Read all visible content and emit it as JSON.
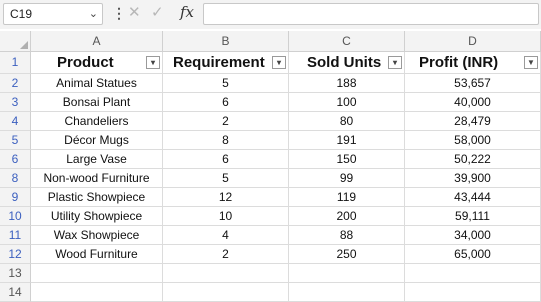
{
  "name_box": {
    "value": "C19"
  },
  "formula_bar": {
    "value": "",
    "fx_label": "fx"
  },
  "columns": [
    "A",
    "B",
    "C",
    "D"
  ],
  "header_row": {
    "row_number": "1",
    "cells": [
      "Product",
      "Requirement",
      "Sold Units",
      "Profit (INR)"
    ]
  },
  "rows": [
    {
      "num": "2",
      "cells": [
        "Animal Statues",
        "5",
        "188",
        "53,657"
      ]
    },
    {
      "num": "3",
      "cells": [
        "Bonsai Plant",
        "6",
        "100",
        "40,000"
      ]
    },
    {
      "num": "4",
      "cells": [
        "Chandeliers",
        "2",
        "80",
        "28,479"
      ]
    },
    {
      "num": "5",
      "cells": [
        "Décor Mugs",
        "8",
        "191",
        "58,000"
      ]
    },
    {
      "num": "6",
      "cells": [
        "Large Vase",
        "6",
        "150",
        "50,222"
      ]
    },
    {
      "num": "8",
      "cells": [
        "Non-wood Furniture",
        "5",
        "99",
        "39,900"
      ]
    },
    {
      "num": "9",
      "cells": [
        "Plastic Showpiece",
        "12",
        "119",
        "43,444"
      ]
    },
    {
      "num": "10",
      "cells": [
        "Utility Showpiece",
        "10",
        "200",
        "59,111"
      ]
    },
    {
      "num": "11",
      "cells": [
        "Wax Showpiece",
        "4",
        "88",
        "34,000"
      ]
    },
    {
      "num": "12",
      "cells": [
        "Wood Furniture",
        "2",
        "250",
        "65,000"
      ]
    }
  ],
  "empty_rows": [
    "13",
    "14"
  ],
  "colors": {
    "filtered_row_number": "#3b5fbf",
    "gridline": "#dcdcdc",
    "header_bg": "#f3f3f3"
  }
}
